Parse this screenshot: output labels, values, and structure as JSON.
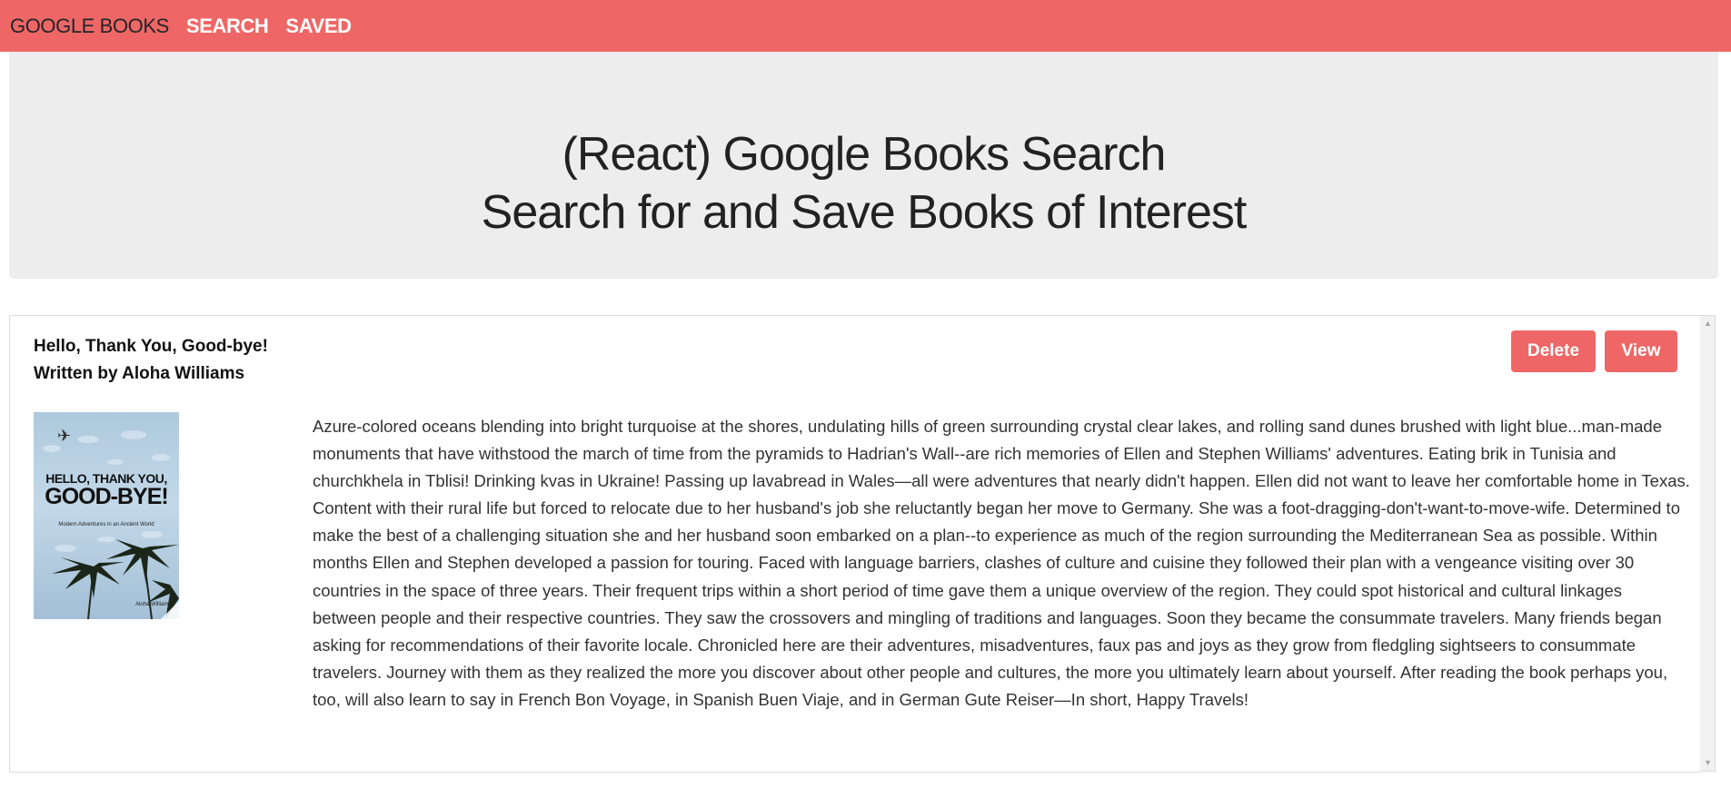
{
  "nav": {
    "brand": "GOOGLE BOOKS",
    "links": [
      "SEARCH",
      "SAVED"
    ]
  },
  "header": {
    "line1": "(React) Google Books Search",
    "line2": "Search for and Save Books of Interest"
  },
  "book": {
    "title": "Hello, Thank You, Good-bye!",
    "author_line": "Written by Aloha Williams",
    "cover": {
      "line1": "HELLO, THANK YOU,",
      "line2": "GOOD-BYE!",
      "subtitle": "Modern Adventures in an Ancient World",
      "author": "Aloha Williams"
    },
    "delete_label": "Delete",
    "view_label": "View",
    "description": "Azure-colored oceans blending into bright turquoise at the shores, undulating hills of green surrounding crystal clear lakes, and rolling sand dunes brushed with light blue...man-made monuments that have withstood the march of time from the pyramids to Hadrian's Wall--are rich memories of Ellen and Stephen Williams' adventures. Eating brik in Tunisia and churchkhela in Tblisi! Drinking kvas in Ukraine! Passing up lavabread in Wales—all were adventures that nearly didn't happen. Ellen did not want to leave her comfortable home in Texas. Content with their rural life but forced to relocate due to her husband's job she reluctantly began her move to Germany. She was a foot-dragging-don't-want-to-move-wife. Determined to make the best of a challenging situation she and her husband soon embarked on a plan--to experience as much of the region surrounding the Mediterranean Sea as possible. Within months Ellen and Stephen developed a passion for touring. Faced with language barriers, clashes of culture and cuisine they followed their plan with a vengeance visiting over 30 countries in the space of three years. Their frequent trips within a short period of time gave them a unique overview of the region. They could spot historical and cultural linkages between people and their respective countries. They saw the crossovers and mingling of traditions and languages. Soon they became the consummate travelers. Many friends began asking for recommendations of their favorite locale. Chronicled here are their adventures, misadventures, faux pas and joys as they grow from fledgling sightseers to consummate travelers. Journey with them as they realized the more you discover about other people and cultures, the more you ultimately learn about yourself. After reading the book perhaps you, too, will also learn to say in French Bon Voyage, in Spanish Buen Viaje, and in German Gute Reiser—In short, Happy Travels!"
  },
  "colors": {
    "accent": "#ee6766",
    "jumbotron_bg": "#ededed"
  },
  "icons": [
    "airplane-icon",
    "chevron-up-icon",
    "chevron-down-icon"
  ]
}
